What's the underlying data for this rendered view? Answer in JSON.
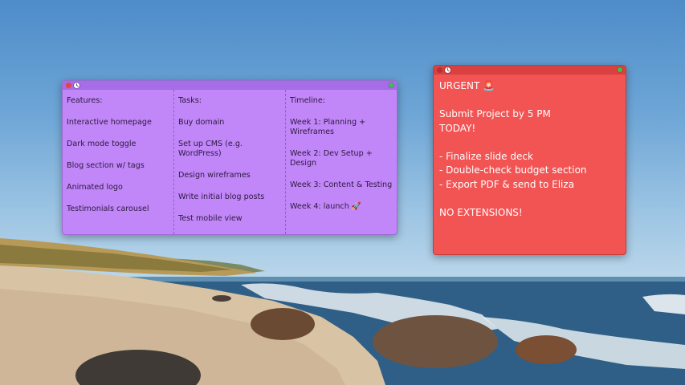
{
  "purple_note": {
    "columns": [
      {
        "heading": "Features:",
        "items": [
          "Interactive homepage",
          "Dark mode toggle",
          "Blog section w/ tags",
          "Animated logo",
          "Testimonials carousel"
        ]
      },
      {
        "heading": "Tasks:",
        "items": [
          "Buy domain",
          "Set up CMS (e.g. WordPress)",
          "Design wireframes",
          "Write initial blog posts",
          "Test mobile view"
        ]
      },
      {
        "heading": "Timeline:",
        "items": [
          "Week 1: Planning + Wireframes",
          "Week 2: Dev Setup + Design",
          "Week 3: Content & Testing",
          "Week 4: launch 🚀"
        ]
      }
    ]
  },
  "red_note": {
    "lines": [
      "URGENT 🚨",
      "",
      "Submit Project by 5 PM",
      "TODAY!",
      "",
      "- Finalize slide deck",
      "- Double-check budget section",
      "- Export PDF & send to Eliza",
      "",
      "NO EXTENSIONS!"
    ]
  }
}
